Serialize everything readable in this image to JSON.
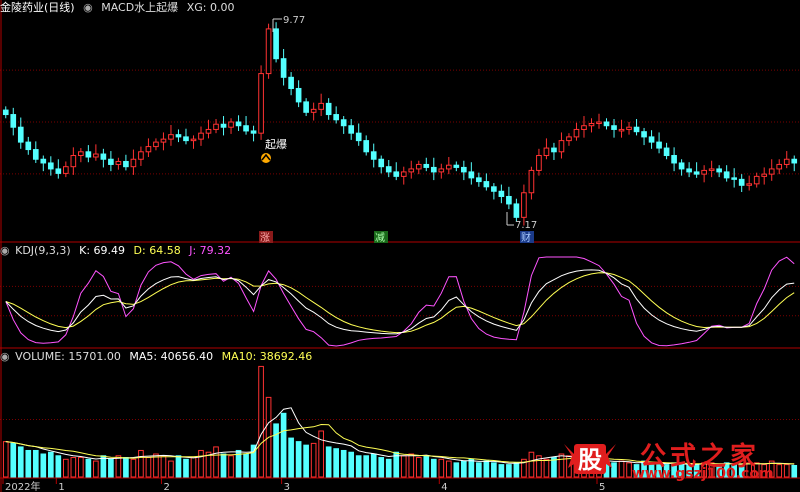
{
  "main_header": {
    "stock_name": "金陵药业(日线)",
    "indicator": "MACD水上起爆",
    "xg_label": "XG: 0.00"
  },
  "kdj_header": {
    "name": "KDJ(9,3,3)",
    "k": "K: 69.49",
    "d": "D: 64.58",
    "j": "J: 79.32"
  },
  "vol_header": {
    "name": "VOLUME: 15701.00",
    "ma5": "MA5: 40656.40",
    "ma10": "MA10: 38692.46"
  },
  "annotations": {
    "high_price": "9.77",
    "low_price": "7.17",
    "signal": "起爆",
    "tag_zhang": "涨",
    "tag_jian": "减",
    "tag_cai": "财"
  },
  "date_axis": [
    "2022年",
    "1",
    "2",
    "3",
    "4",
    "5"
  ],
  "watermark": {
    "glyph": "股",
    "brand": "公式之家",
    "url": "www.gszj100.com"
  },
  "colors": {
    "up": "#ff3232",
    "down": "#54ffff",
    "k_line": "#ffffff",
    "d_line": "#ffff54",
    "j_line": "#ff54ff",
    "ma5": "#ffffff",
    "ma10": "#ffff54",
    "grid": "#7a0000",
    "watermark": "#e01e1e"
  },
  "chart_data": [
    {
      "type": "candlestick",
      "title": "金陵药业(日线)",
      "series_note": "daily price, candles approximate",
      "close": [
        8.55,
        8.38,
        8.18,
        8.08,
        7.95,
        7.9,
        7.82,
        7.76,
        7.85,
        8.0,
        8.05,
        7.98,
        8.02,
        7.95,
        7.88,
        7.92,
        7.85,
        7.95,
        8.05,
        8.12,
        8.18,
        8.22,
        8.28,
        8.25,
        8.2,
        8.22,
        8.3,
        8.35,
        8.42,
        8.38,
        8.45,
        8.4,
        8.33,
        8.3,
        9.1,
        9.7,
        9.3,
        9.05,
        8.9,
        8.72,
        8.58,
        8.62,
        8.7,
        8.55,
        8.48,
        8.4,
        8.3,
        8.2,
        8.05,
        7.95,
        7.85,
        7.78,
        7.72,
        7.78,
        7.82,
        7.88,
        7.84,
        7.78,
        7.82,
        7.87,
        7.84,
        7.78,
        7.7,
        7.65,
        7.58,
        7.52,
        7.45,
        7.35,
        7.17,
        7.5,
        7.8,
        8.0,
        8.1,
        8.05,
        8.2,
        8.25,
        8.35,
        8.4,
        8.43,
        8.45,
        8.4,
        8.35,
        8.35,
        8.38,
        8.32,
        8.25,
        8.18,
        8.1,
        8.0,
        7.9,
        7.82,
        7.78,
        7.75,
        7.8,
        7.82,
        7.78,
        7.7,
        7.68,
        7.6,
        7.62,
        7.72,
        7.75,
        7.82,
        7.88,
        7.95,
        7.9
      ],
      "high": "9.77",
      "low": "7.17"
    },
    {
      "type": "line",
      "title": "KDJ(9,3,3)",
      "series": [
        {
          "name": "K",
          "last": 69.49
        },
        {
          "name": "D",
          "last": 64.58
        },
        {
          "name": "J",
          "last": 79.32
        }
      ]
    },
    {
      "type": "bar",
      "title": "VOLUME",
      "last": 15701.0,
      "series": [
        {
          "name": "MA5",
          "last": 40656.4
        },
        {
          "name": "MA10",
          "last": 38692.46
        }
      ],
      "values": [
        40,
        38,
        34,
        30,
        30,
        26,
        28,
        24,
        20,
        22,
        22,
        20,
        18,
        24,
        20,
        24,
        22,
        20,
        30,
        22,
        26,
        24,
        18,
        24,
        20,
        22,
        30,
        28,
        34,
        26,
        24,
        30,
        26,
        36,
        125,
        90,
        60,
        72,
        44,
        40,
        36,
        38,
        52,
        34,
        32,
        30,
        28,
        24,
        24,
        26,
        22,
        20,
        28,
        24,
        26,
        22,
        24,
        20,
        20,
        18,
        16,
        18,
        20,
        16,
        18,
        16,
        14,
        14,
        16,
        20,
        28,
        24,
        20,
        22,
        26,
        24,
        20,
        18,
        18,
        20,
        16,
        16,
        18,
        16,
        14,
        18,
        16,
        14,
        14,
        16,
        14,
        14,
        14,
        16,
        16,
        14,
        16,
        14,
        14,
        16,
        16,
        14,
        18,
        14,
        14,
        13
      ]
    }
  ]
}
